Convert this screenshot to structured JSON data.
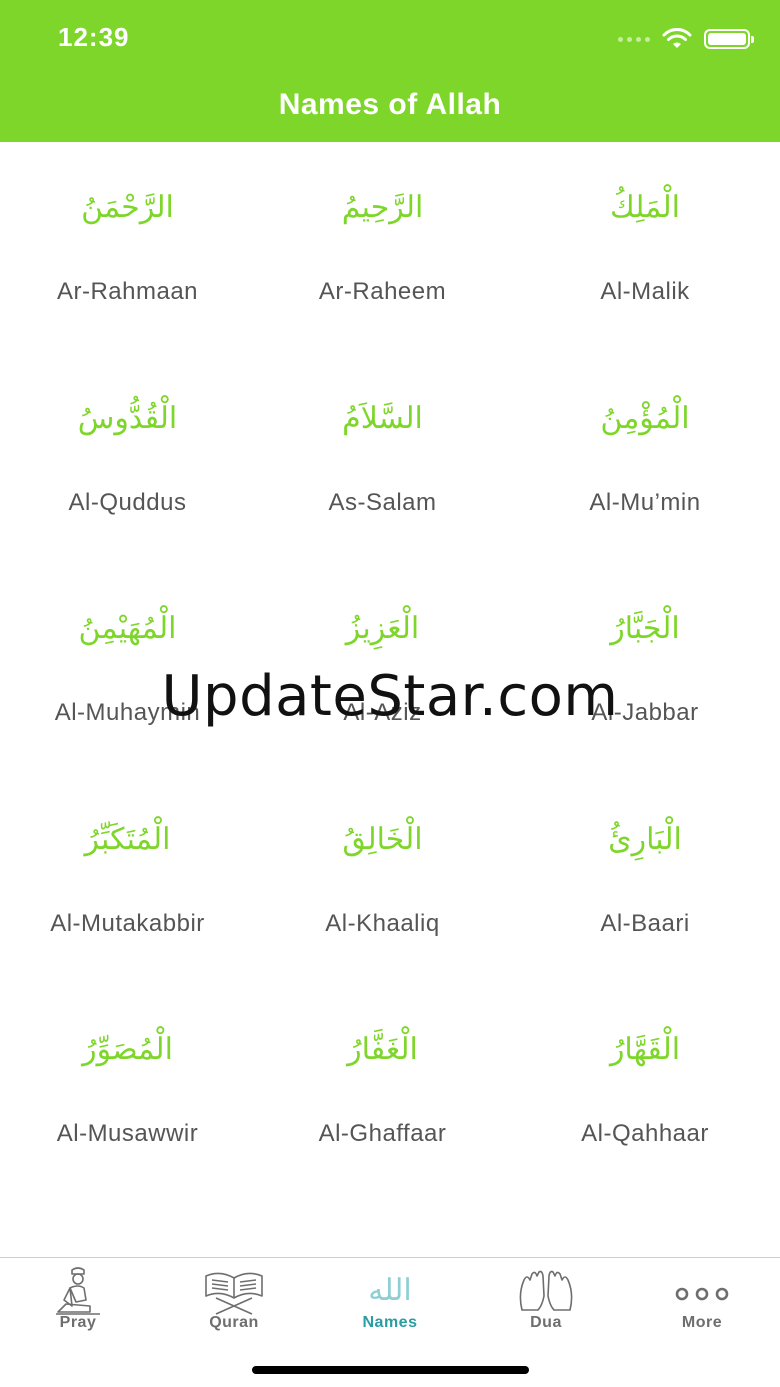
{
  "status_bar": {
    "time": "12:39"
  },
  "header": {
    "title": "Names of Allah"
  },
  "names": [
    {
      "arabic": "الرَّحْمَنُ",
      "transliteration": "Ar-Rahmaan"
    },
    {
      "arabic": "الرَّحِيمُ",
      "transliteration": "Ar-Raheem"
    },
    {
      "arabic": "الْمَلِكُ",
      "transliteration": "Al-Malik"
    },
    {
      "arabic": "الْقُدُّوسُ",
      "transliteration": "Al-Quddus"
    },
    {
      "arabic": "السَّلاَمُ",
      "transliteration": "As-Salam"
    },
    {
      "arabic": "الْمُؤْمِنُ",
      "transliteration": "Al-Mu’min"
    },
    {
      "arabic": "الْمُهَيْمِنُ",
      "transliteration": "Al-Muhaymin"
    },
    {
      "arabic": "الْعَزِيزُ",
      "transliteration": "Al-Aziz"
    },
    {
      "arabic": "الْجَبَّارُ",
      "transliteration": "Al-Jabbar"
    },
    {
      "arabic": "الْمُتَكَبِّرُ",
      "transliteration": "Al-Mutakabbir"
    },
    {
      "arabic": "الْخَالِقُ",
      "transliteration": "Al-Khaaliq"
    },
    {
      "arabic": "الْبَارِئُ",
      "transliteration": "Al-Baari"
    },
    {
      "arabic": "الْمُصَوِّرُ",
      "transliteration": "Al-Musawwir"
    },
    {
      "arabic": "الْغَفَّارُ",
      "transliteration": "Al-Ghaffaar"
    },
    {
      "arabic": "الْقَهَّارُ",
      "transliteration": "Al-Qahhaar"
    }
  ],
  "watermark": "UpdateStar.com",
  "tabs": [
    {
      "label": "Pray",
      "icon": "pray-icon"
    },
    {
      "label": "Quran",
      "icon": "quran-icon"
    },
    {
      "label": "Names",
      "icon": "names-allah-icon",
      "active": true,
      "icon_text": "الله"
    },
    {
      "label": "Dua",
      "icon": "dua-hands-icon"
    },
    {
      "label": "More",
      "icon": "more-dots-icon"
    }
  ],
  "colors": {
    "accent_green": "#7ed62a",
    "active_tab": "#2a9da3",
    "text_gray": "#555555"
  }
}
